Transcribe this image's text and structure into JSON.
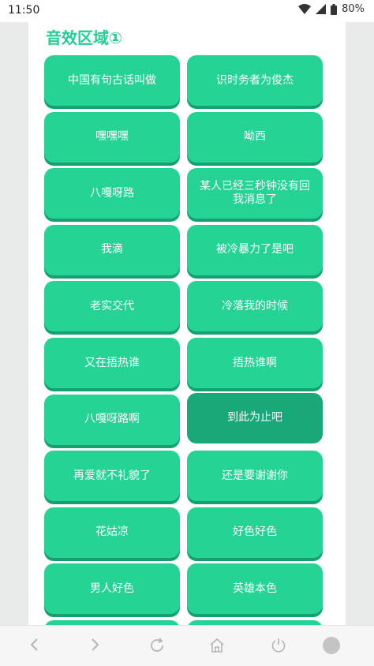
{
  "status": {
    "time": "11:50",
    "battery": "80%"
  },
  "section": {
    "title": "音效区域①"
  },
  "buttons": [
    "中国有句古话叫做",
    "识时务者为俊杰",
    "嘿嘿嘿",
    "呦西",
    "八嘎呀路",
    "某人已经三秒钟没有回我消息了",
    "我滴",
    "被冷暴力了是吧",
    "老实交代",
    "冷落我的时候",
    "又在捂热谁",
    "捂热谁啊",
    "八嘎呀路啊",
    "到此为止吧",
    "再爱就不礼貌了",
    "还是要谢谢你",
    "花姑凉",
    "好色好色",
    "男人好色",
    "英雄本色"
  ],
  "active_index": 13,
  "colors": {
    "accent": "#25d495",
    "accent_dark": "#1aa878",
    "title": "#22cf92"
  },
  "nav_icons": [
    "back-icon",
    "forward-icon",
    "refresh-icon",
    "home-icon",
    "power-icon",
    "record-icon"
  ]
}
